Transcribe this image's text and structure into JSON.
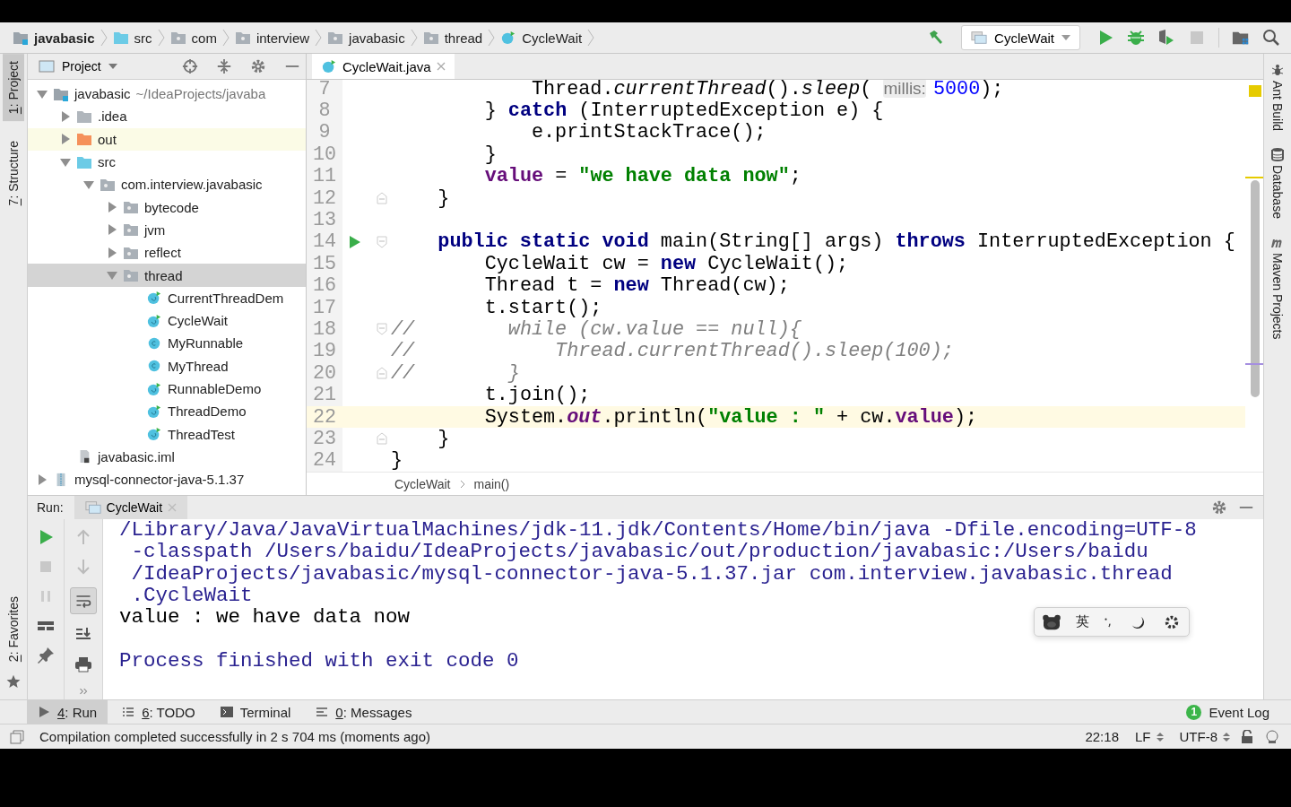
{
  "nav_bar": {
    "breadcrumbs": [
      {
        "label": "javabasic",
        "kind": "module"
      },
      {
        "label": "src",
        "kind": "source-folder"
      },
      {
        "label": "com",
        "kind": "package"
      },
      {
        "label": "interview",
        "kind": "package"
      },
      {
        "label": "javabasic",
        "kind": "package"
      },
      {
        "label": "thread",
        "kind": "package"
      },
      {
        "label": "CycleWait",
        "kind": "class-runnable"
      }
    ],
    "run_config": "CycleWait"
  },
  "left_strip": [
    {
      "mnemonic": "1",
      "label": ": Project",
      "selected": true
    },
    {
      "mnemonic": "7",
      "label": ": Structure",
      "selected": false
    }
  ],
  "favorites": {
    "mnemonic": "2",
    "label": ": Favorites"
  },
  "right_strip": [
    {
      "label": "Ant Build",
      "kind": "ant"
    },
    {
      "label": "Database",
      "kind": "database"
    },
    {
      "label": "Maven Projects",
      "kind": "maven"
    }
  ],
  "project_panel": {
    "title": "Project",
    "tree": [
      {
        "label": "javabasic",
        "suffix": "~/IdeaProjects/javaba",
        "kind": "module",
        "expanded": true,
        "selected": false,
        "highlighted": false,
        "children": [
          {
            "label": ".idea",
            "kind": "folder",
            "expanded": false,
            "selected": false,
            "highlighted": false
          },
          {
            "label": "out",
            "kind": "folder-excluded",
            "expanded": false,
            "selected": false,
            "highlighted": true
          },
          {
            "label": "src",
            "kind": "source-folder",
            "expanded": true,
            "selected": false,
            "highlighted": false,
            "children": [
              {
                "label": "com.interview.javabasic",
                "kind": "package",
                "expanded": true,
                "selected": false,
                "highlighted": false,
                "children": [
                  {
                    "label": "bytecode",
                    "kind": "package",
                    "expanded": false,
                    "selected": false,
                    "highlighted": false
                  },
                  {
                    "label": "jvm",
                    "kind": "package",
                    "expanded": false,
                    "selected": false,
                    "highlighted": false
                  },
                  {
                    "label": "reflect",
                    "kind": "package",
                    "expanded": false,
                    "selected": false,
                    "highlighted": false
                  },
                  {
                    "label": "thread",
                    "kind": "package",
                    "expanded": true,
                    "selected": true,
                    "highlighted": false,
                    "children": [
                      {
                        "label": "CurrentThreadDem",
                        "kind": "class-runnable",
                        "selected": false,
                        "highlighted": false
                      },
                      {
                        "label": "CycleWait",
                        "kind": "class-runnable",
                        "selected": false,
                        "highlighted": false
                      },
                      {
                        "label": "MyRunnable",
                        "kind": "class",
                        "selected": false,
                        "highlighted": false
                      },
                      {
                        "label": "MyThread",
                        "kind": "class",
                        "selected": false,
                        "highlighted": false
                      },
                      {
                        "label": "RunnableDemo",
                        "kind": "class-runnable",
                        "selected": false,
                        "highlighted": false
                      },
                      {
                        "label": "ThreadDemo",
                        "kind": "class-runnable",
                        "selected": false,
                        "highlighted": false
                      },
                      {
                        "label": "ThreadTest",
                        "kind": "class-runnable",
                        "selected": false,
                        "highlighted": false
                      }
                    ]
                  }
                ]
              }
            ]
          },
          {
            "label": "javabasic.iml",
            "kind": "iml",
            "selected": false,
            "highlighted": false
          }
        ]
      },
      {
        "label": "mysql-connector-java-5.1.37",
        "kind": "jar",
        "expanded": false,
        "selected": false,
        "highlighted": false
      }
    ]
  },
  "editor": {
    "tabs": [
      {
        "label": "CycleWait.java",
        "selected": true
      }
    ],
    "lines": [
      {
        "number": "7",
        "current": false,
        "tokens": [
          {
            "kind": "plain",
            "text": "            Thread."
          },
          {
            "kind": "static",
            "text": "currentThread"
          },
          {
            "kind": "plain",
            "text": "()."
          },
          {
            "kind": "static",
            "text": "sleep"
          },
          {
            "kind": "plain",
            "text": "( "
          },
          {
            "kind": "hint",
            "text": "millis:"
          },
          {
            "kind": "number",
            "text": "5000"
          },
          {
            "kind": "plain",
            "text": ");"
          }
        ]
      },
      {
        "number": "8",
        "current": false,
        "tokens": [
          {
            "kind": "plain",
            "text": "        } "
          },
          {
            "kind": "keyword",
            "text": "catch"
          },
          {
            "kind": "plain",
            "text": " (InterruptedException e) {"
          }
        ]
      },
      {
        "number": "9",
        "current": false,
        "tokens": [
          {
            "kind": "plain",
            "text": "            e.printStackTrace();"
          }
        ]
      },
      {
        "number": "10",
        "current": false,
        "tokens": [
          {
            "kind": "plain",
            "text": "        }"
          }
        ]
      },
      {
        "number": "11",
        "current": false,
        "tokens": [
          {
            "kind": "field",
            "text": "        value"
          },
          {
            "kind": "plain",
            "text": " = "
          },
          {
            "kind": "string",
            "text": "\"we have data now\""
          },
          {
            "kind": "plain",
            "text": ";"
          }
        ]
      },
      {
        "number": "12",
        "current": false,
        "gutter": [
          {
            "kind": "fold-end"
          }
        ],
        "tokens": [
          {
            "kind": "plain",
            "text": "    }"
          }
        ]
      },
      {
        "number": "13",
        "current": false
      },
      {
        "number": "14",
        "current": false,
        "gutter": [
          {
            "kind": "run"
          },
          {
            "kind": "fold-start"
          }
        ],
        "tokens": [
          {
            "kind": "keyword",
            "text": "    public static void"
          },
          {
            "kind": "plain",
            "text": " main(String[] args) "
          },
          {
            "kind": "keyword",
            "text": "throws"
          },
          {
            "kind": "plain",
            "text": " InterruptedException {"
          }
        ]
      },
      {
        "number": "15",
        "current": false,
        "tokens": [
          {
            "kind": "plain",
            "text": "        CycleWait cw = "
          },
          {
            "kind": "keyword",
            "text": "new"
          },
          {
            "kind": "plain",
            "text": " CycleWait();"
          }
        ]
      },
      {
        "number": "16",
        "current": false,
        "tokens": [
          {
            "kind": "plain",
            "text": "        Thread t = "
          },
          {
            "kind": "keyword",
            "text": "new"
          },
          {
            "kind": "plain",
            "text": " Thread(cw);"
          }
        ]
      },
      {
        "number": "17",
        "current": false,
        "tokens": [
          {
            "kind": "plain",
            "text": "        t.start();"
          }
        ]
      },
      {
        "number": "18",
        "current": false,
        "gutter": [
          {
            "kind": "fold-start"
          }
        ],
        "tokens": [
          {
            "kind": "comment",
            "text": "//        while (cw.value == null){"
          }
        ]
      },
      {
        "number": "19",
        "current": false,
        "tokens": [
          {
            "kind": "comment",
            "text": "//            Thread.currentThread().sleep(100);"
          }
        ]
      },
      {
        "number": "20",
        "current": false,
        "gutter": [
          {
            "kind": "fold-end"
          }
        ],
        "tokens": [
          {
            "kind": "comment",
            "text": "//        }"
          }
        ]
      },
      {
        "number": "21",
        "current": false,
        "tokens": [
          {
            "kind": "plain",
            "text": "        t.join();"
          }
        ]
      },
      {
        "number": "22",
        "current": true,
        "tokens": [
          {
            "kind": "plain",
            "text": "        System."
          },
          {
            "kind": "static-field",
            "text": "out"
          },
          {
            "kind": "plain",
            "text": ".println("
          },
          {
            "kind": "string",
            "text": "\"value : \""
          },
          {
            "kind": "plain",
            "text": " + cw."
          },
          {
            "kind": "field",
            "text": "value"
          },
          {
            "kind": "plain",
            "text": ");"
          }
        ]
      },
      {
        "number": "23",
        "current": false,
        "gutter": [
          {
            "kind": "fold-end"
          }
        ],
        "tokens": [
          {
            "kind": "plain",
            "text": "    }"
          }
        ]
      },
      {
        "number": "24",
        "current": false,
        "tokens": [
          {
            "kind": "plain",
            "text": "}"
          }
        ]
      }
    ],
    "breadcrumb": [
      "CycleWait",
      "main()"
    ]
  },
  "run_panel": {
    "label": "Run:",
    "tabs": [
      {
        "label": "CycleWait",
        "selected": true
      }
    ],
    "console": [
      {
        "kind": "command",
        "text": "/Library/Java/JavaVirtualMachines/jdk-11.jdk/Contents/Home/bin/java -Dfile.encoding=UTF-8"
      },
      {
        "kind": "command",
        "text": " -classpath /Users/baidu/IdeaProjects/javabasic/out/production/javabasic:/Users/baidu"
      },
      {
        "kind": "command",
        "text": " /IdeaProjects/javabasic/mysql-connector-java-5.1.37.jar com.interview.javabasic.thread"
      },
      {
        "kind": "command",
        "text": " .CycleWait"
      },
      {
        "kind": "output",
        "text": "value : we have data now"
      },
      {
        "kind": "process",
        "text": "Process finished with exit code 0"
      }
    ]
  },
  "ime_bar": {
    "mode": "英"
  },
  "tool_windows": [
    {
      "mnemonic": "4",
      "label": ": Run",
      "kind": "run",
      "selected": true
    },
    {
      "mnemonic": "6",
      "label": ": TODO",
      "kind": "list",
      "selected": false
    },
    {
      "label": "Terminal",
      "kind": "terminal",
      "selected": false
    },
    {
      "mnemonic": "0",
      "label": ": Messages",
      "kind": "messages",
      "selected": false
    }
  ],
  "event_log": {
    "badge": "1",
    "label": "Event Log"
  },
  "status_bar": {
    "message": "Compilation completed successfully in 2 s 704 ms (moments ago)",
    "position": "22:18",
    "line_separator": "LF",
    "encoding": "UTF-8"
  }
}
